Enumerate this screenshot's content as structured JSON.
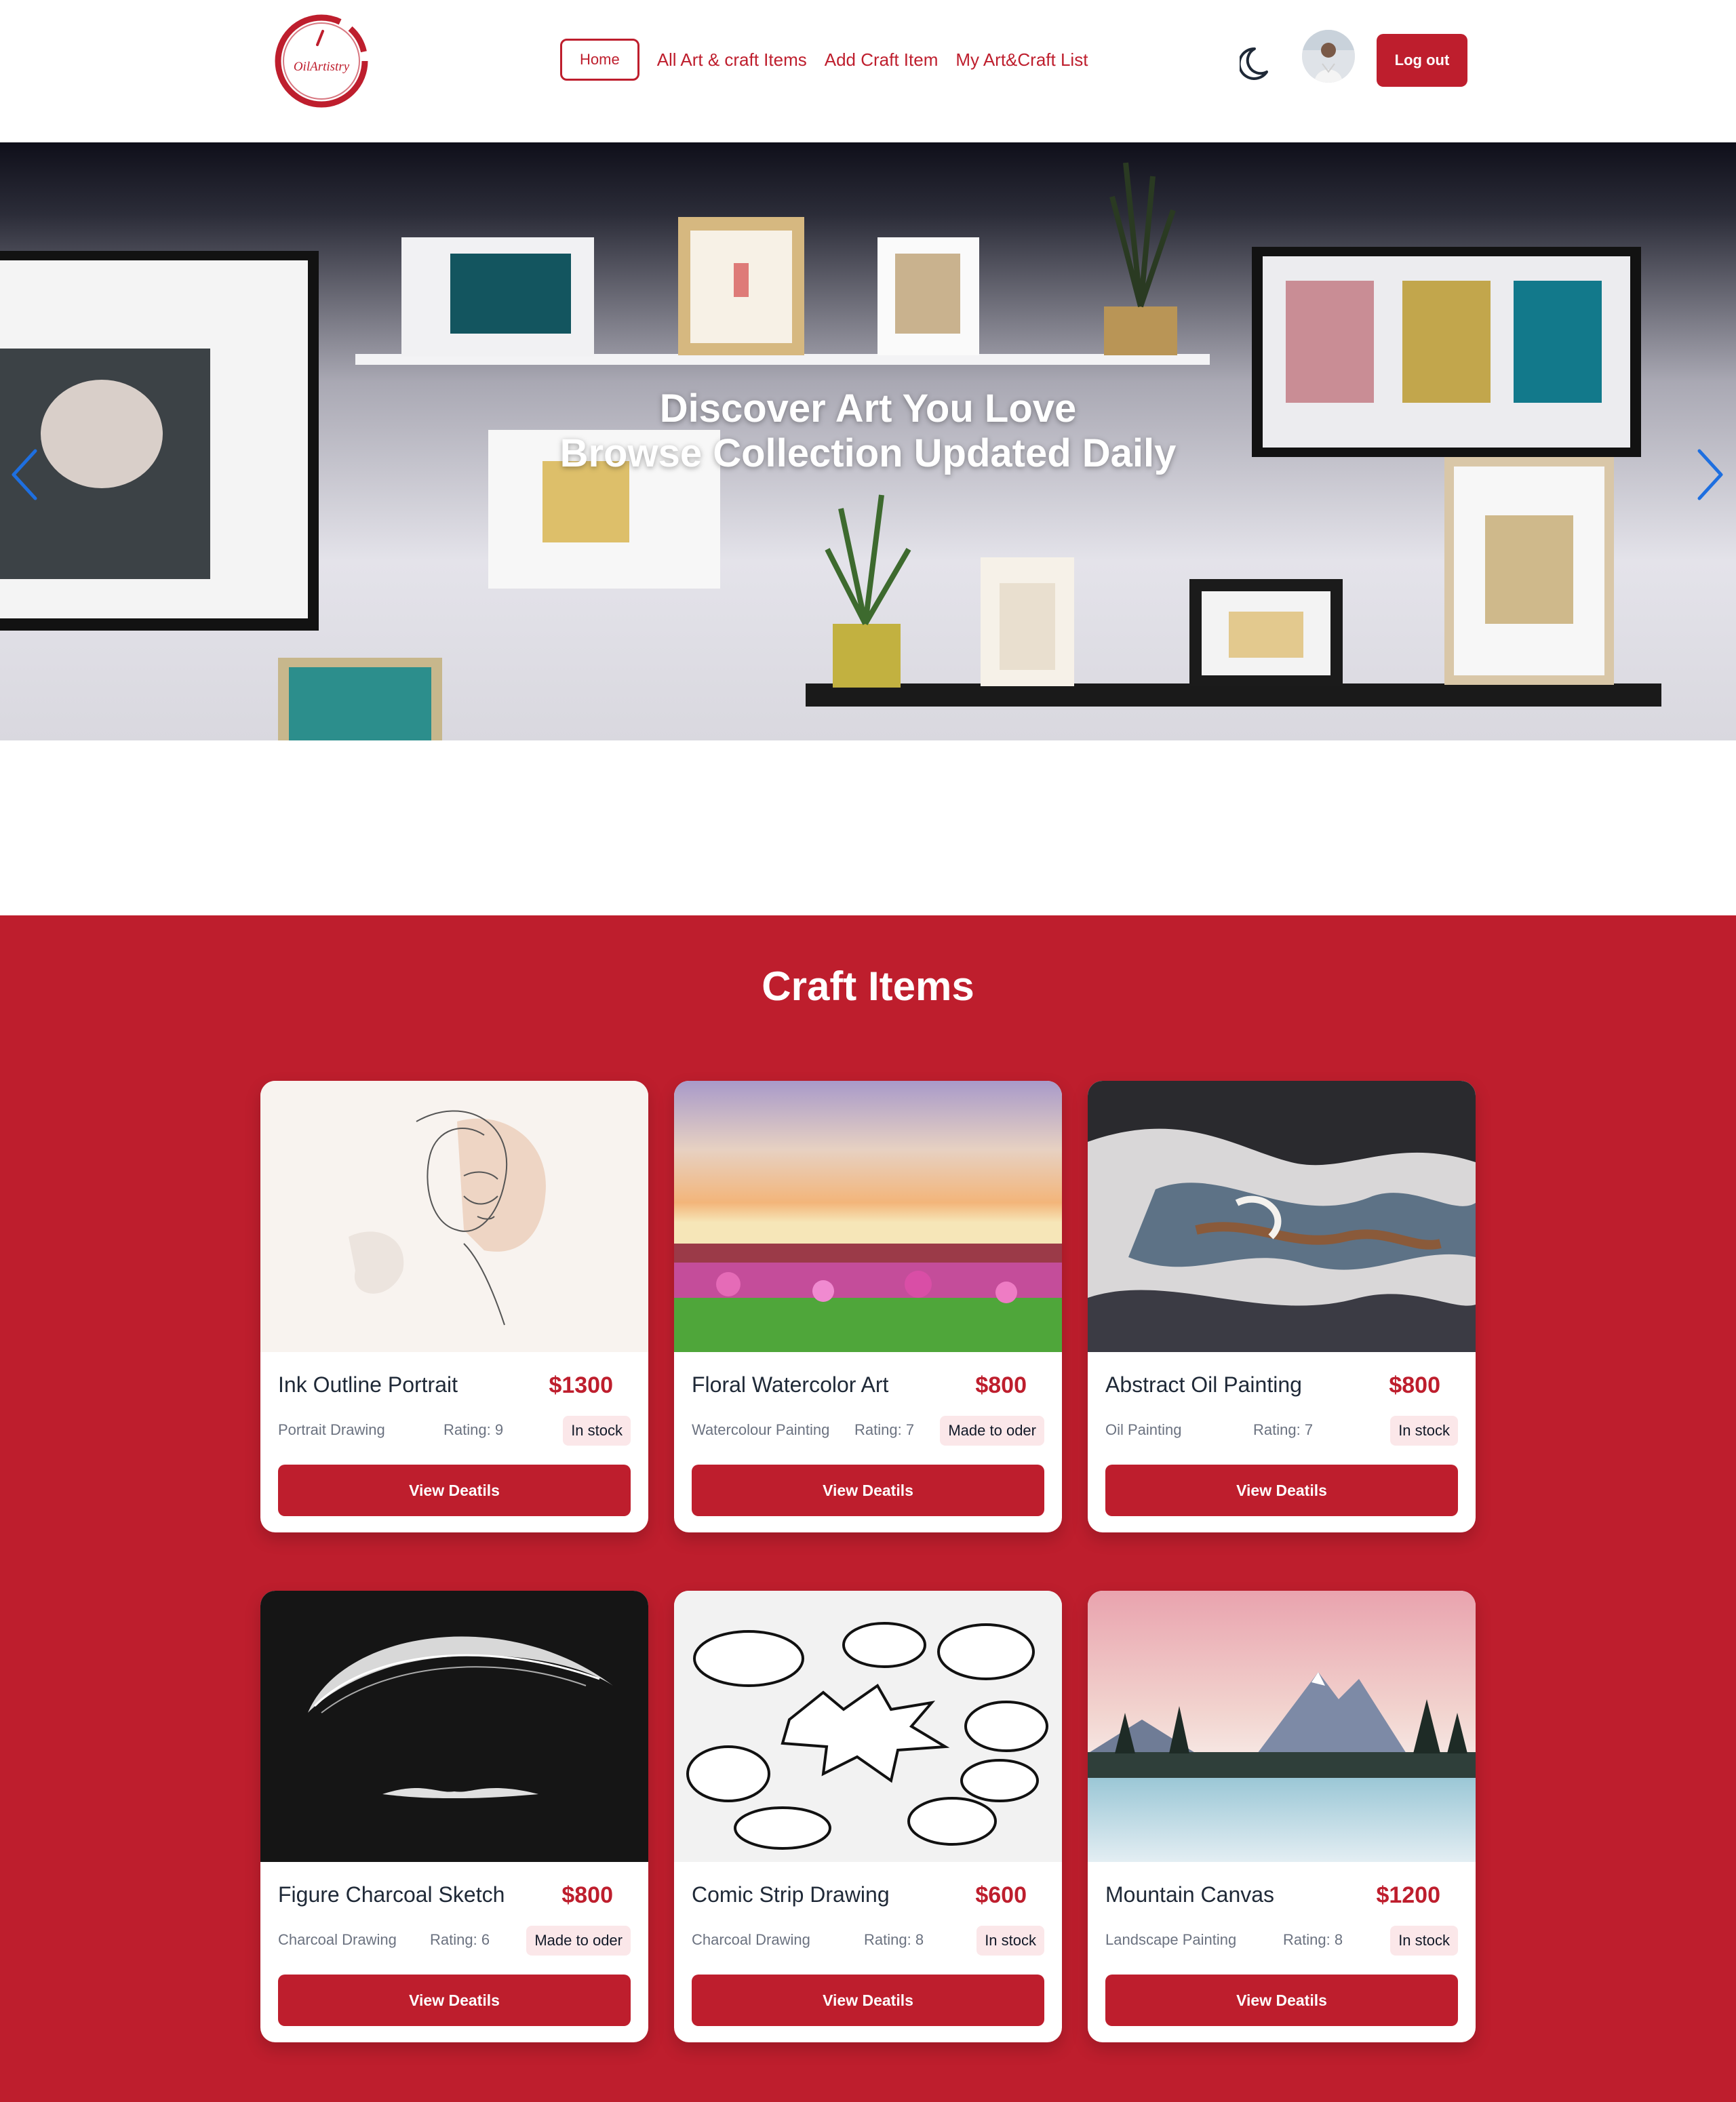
{
  "brand": {
    "logo_text": "OilArtistry",
    "accent": "#be1e2d"
  },
  "nav": {
    "links": [
      {
        "label": "Home",
        "active": true
      },
      {
        "label": "All Art & craft Items",
        "active": false
      },
      {
        "label": "Add Craft Item",
        "active": false
      },
      {
        "label": "My Art&Craft List",
        "active": false
      }
    ],
    "theme_icon": "moon-icon",
    "logout_label": "Log out"
  },
  "hero": {
    "title_line1": "Discover Art You Love",
    "title_line2": "Browse Collection Updated Daily",
    "prev_icon": "chevron-left-icon",
    "next_icon": "chevron-right-icon"
  },
  "section": {
    "title": "Craft Items"
  },
  "items": [
    {
      "name": "Ink Outline Portrait",
      "price": "$1300",
      "category": "Portrait Drawing",
      "rating": "Rating: 9",
      "status": "In stock",
      "button": "View Deatils"
    },
    {
      "name": "Floral Watercolor Art",
      "price": "$800",
      "category": "Watercolour Painting",
      "rating": "Rating: 7",
      "status": "Made to oder",
      "button": "View Deatils"
    },
    {
      "name": "Abstract Oil Painting",
      "price": "$800",
      "category": "Oil Painting",
      "rating": "Rating: 7",
      "status": "In stock",
      "button": "View Deatils"
    },
    {
      "name": "Figure Charcoal Sketch",
      "price": "$800",
      "category": "Charcoal Drawing",
      "rating": "Rating: 6",
      "status": "Made to oder",
      "button": "View Deatils"
    },
    {
      "name": "Comic Strip Drawing",
      "price": "$600",
      "category": "Charcoal Drawing",
      "rating": "Rating: 8",
      "status": "In stock",
      "button": "View Deatils"
    },
    {
      "name": "Mountain Canvas",
      "price": "$1200",
      "category": "Landscape Painting",
      "rating": "Rating: 8",
      "status": "In stock",
      "button": "View Deatils"
    }
  ]
}
